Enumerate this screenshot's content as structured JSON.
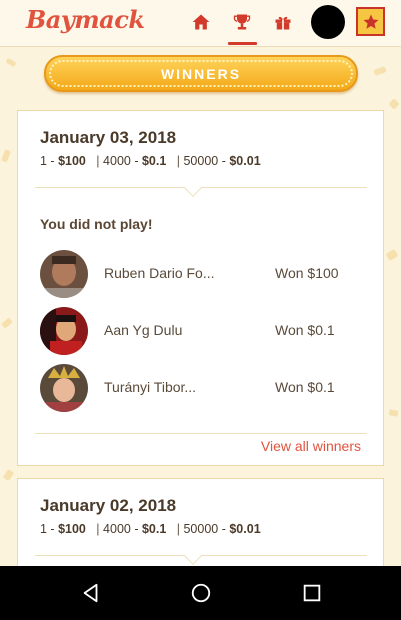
{
  "app": {
    "logo": "Baymack"
  },
  "header": {
    "nav": [
      {
        "name": "home",
        "icon": "home-icon"
      },
      {
        "name": "winners",
        "icon": "trophy-icon",
        "active": true
      },
      {
        "name": "gifts",
        "icon": "gift-icon"
      }
    ],
    "star_icon": "star-icon",
    "colors": {
      "accent": "#e0533e",
      "active": "#d23b2c",
      "gold": "#f6c542"
    }
  },
  "banner": {
    "title": "WINNERS"
  },
  "draws": [
    {
      "date": "January 03, 2018",
      "prizes": [
        {
          "rank": "1",
          "amount": "$100"
        },
        {
          "rank": "4000",
          "amount": "$0.1"
        },
        {
          "rank": "50000",
          "amount": "$0.01"
        }
      ],
      "status": "You did not play!",
      "winners": [
        {
          "name": "Ruben Dario Fo...",
          "result": "Won $100"
        },
        {
          "name": "Aan Yg Dulu",
          "result": "Won $0.1"
        },
        {
          "name": "Turányi Tibor...",
          "result": "Won $0.1"
        }
      ],
      "view_all": "View all winners"
    },
    {
      "date": "January 02, 2018",
      "prizes": [
        {
          "rank": "1",
          "amount": "$100"
        },
        {
          "rank": "4000",
          "amount": "$0.1"
        },
        {
          "rank": "50000",
          "amount": "$0.01"
        }
      ]
    }
  ],
  "sysbar": {
    "buttons": [
      "back-icon",
      "home-circle-icon",
      "recents-icon"
    ]
  }
}
